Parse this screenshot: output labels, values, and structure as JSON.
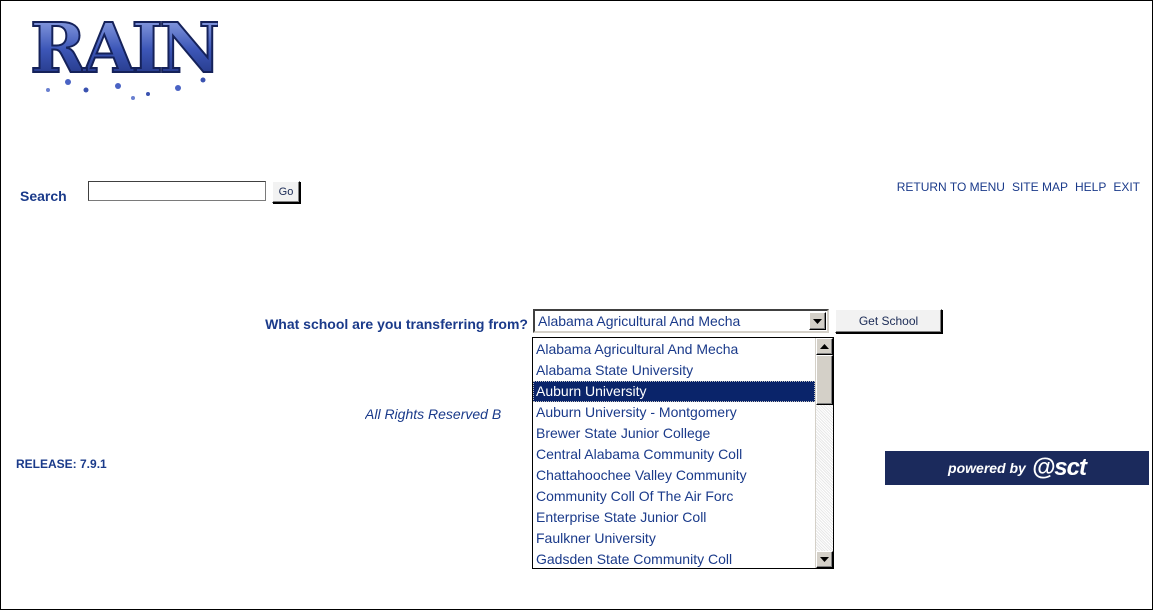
{
  "logo": {
    "text": "RAIN"
  },
  "search": {
    "label": "Search",
    "value": "",
    "go_label": "Go"
  },
  "toplinks": [
    "RETURN TO MENU",
    "SITE MAP",
    "HELP",
    "EXIT"
  ],
  "transfer": {
    "question": "What school are you transferring from?",
    "selected": "Alabama Agricultural And Mecha",
    "button_label": "Get School",
    "options": [
      "Alabama Agricultural And Mecha",
      "Alabama State University",
      "Auburn University",
      "Auburn University - Montgomery",
      "Brewer State Junior College",
      "Central Alabama Community Coll",
      "Chattahoochee Valley Community",
      "Community Coll Of The Air Forc",
      "Enterprise State Junior Coll",
      "Faulkner University",
      "Gadsden State Community Coll"
    ],
    "highlighted_index": 2
  },
  "footer": {
    "rights": "All Rights Reserved B",
    "release": "RELEASE: 7.9.1",
    "powered_by": "powered by",
    "brand": "@sct"
  },
  "colors": {
    "text": "#1a3a8a",
    "highlight": "#0a246a",
    "badge": "#1b2a5c"
  }
}
